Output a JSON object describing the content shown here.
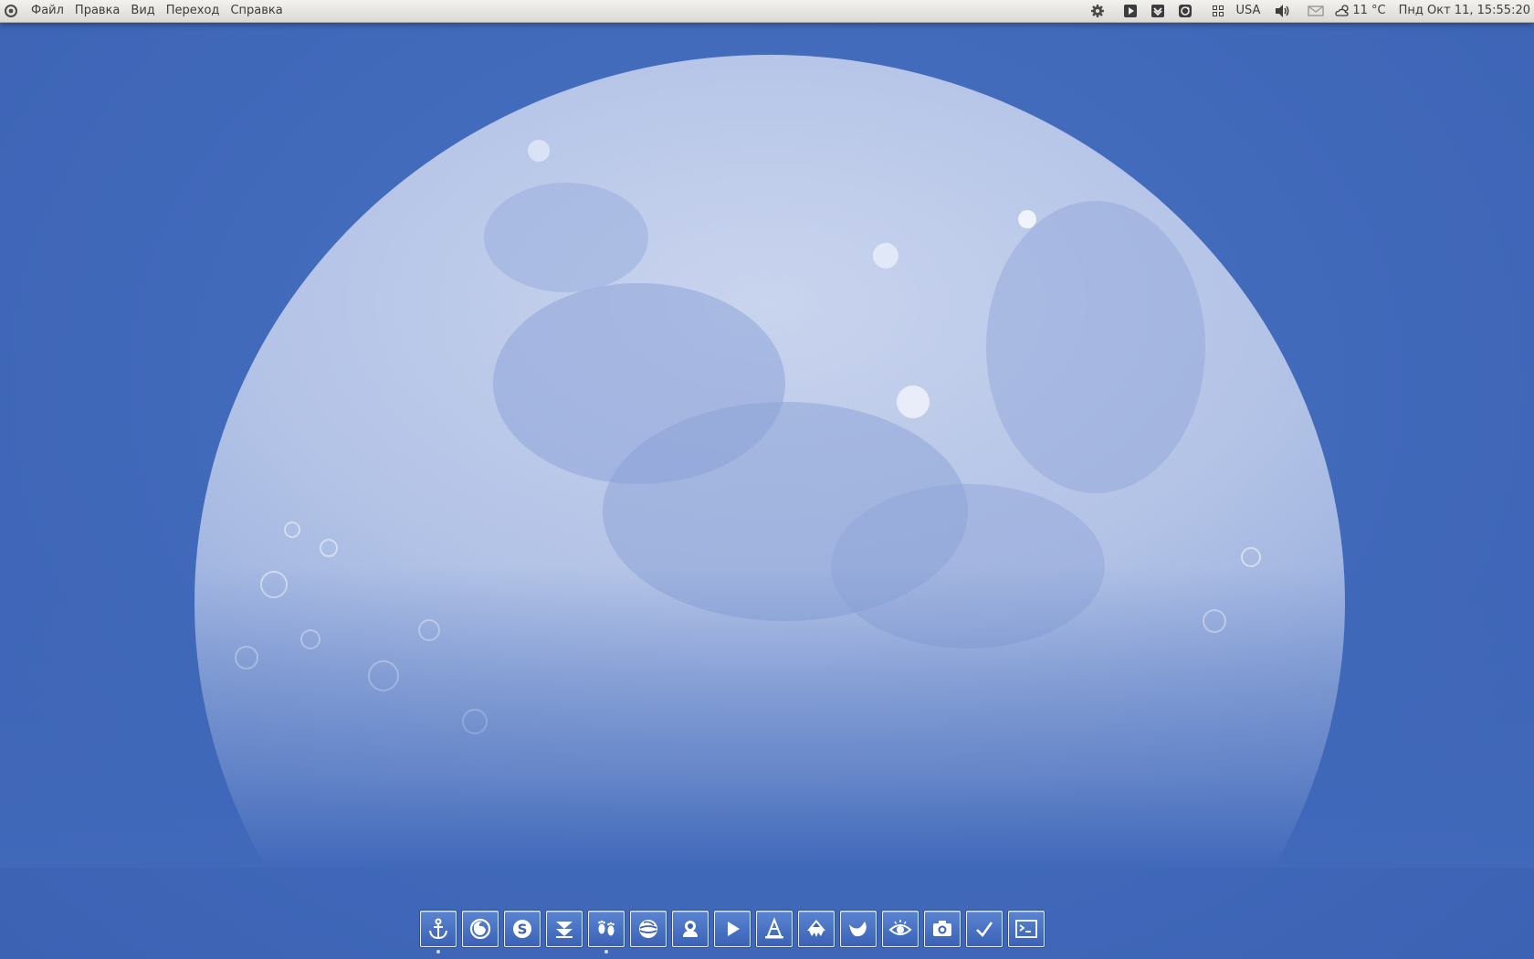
{
  "screen": {
    "wallpaper": "half-moon-blue-sky",
    "accent": "#4169ba"
  },
  "top_panel": {
    "logo_icon": "ubuntu-circle-icon",
    "menu": [
      {
        "label": "Файл"
      },
      {
        "label": "Правка"
      },
      {
        "label": "Вид"
      },
      {
        "label": "Переход"
      },
      {
        "label": "Справка"
      }
    ],
    "indicators": {
      "settings_icon": "gear-icon",
      "media_icon": "play-box-icon",
      "download_icon": "download-box-icon",
      "sync_icon": "sync-icon",
      "keyboard_icon": "keyboard-layout-icon",
      "keyboard_layout": "USA",
      "volume_icon": "speaker-icon",
      "mail_icon": "envelope-icon",
      "weather_icon": "cloud-sun-icon",
      "temperature": "11 °C",
      "datetime": "Пнд Окт 11, 15:55:20"
    }
  },
  "dock": {
    "items": [
      {
        "icon": "anchor-icon",
        "running": true
      },
      {
        "icon": "firefox-icon",
        "running": false
      },
      {
        "icon": "skype-icon",
        "running": false
      },
      {
        "icon": "download-chevron-icon",
        "running": false
      },
      {
        "icon": "footprints-icon",
        "running": true
      },
      {
        "icon": "globe-icon",
        "running": false
      },
      {
        "icon": "chat-contacts-icon",
        "running": false
      },
      {
        "icon": "play-icon",
        "running": false
      },
      {
        "icon": "vlc-cone-icon",
        "running": false
      },
      {
        "icon": "inkscape-icon",
        "running": false
      },
      {
        "icon": "bird-icon",
        "running": false
      },
      {
        "icon": "eye-icon",
        "running": false
      },
      {
        "icon": "camera-icon",
        "running": false
      },
      {
        "icon": "checkmark-icon",
        "running": false
      },
      {
        "icon": "terminal-icon",
        "running": false
      }
    ]
  }
}
